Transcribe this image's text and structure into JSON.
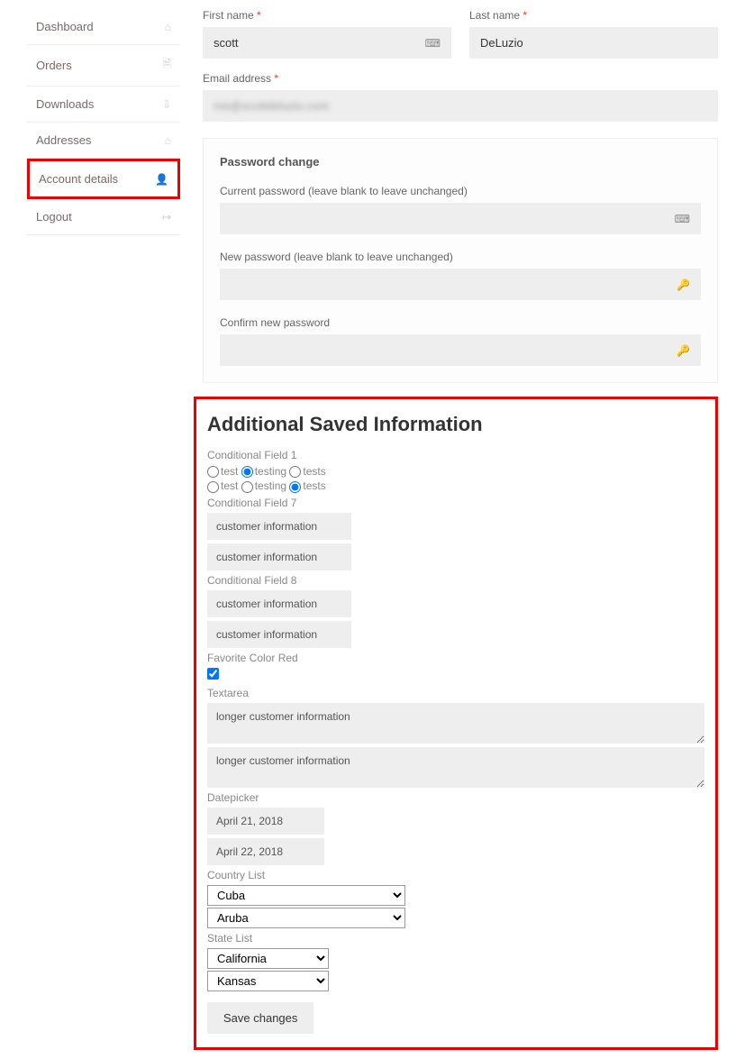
{
  "sidebar": {
    "items": [
      {
        "label": "Dashboard",
        "icon": "⌂"
      },
      {
        "label": "Orders",
        "icon": "🗎"
      },
      {
        "label": "Downloads",
        "icon": "⇩"
      },
      {
        "label": "Addresses",
        "icon": "⌂"
      },
      {
        "label": "Account details",
        "icon": "👤"
      },
      {
        "label": "Logout",
        "icon": "↦"
      }
    ]
  },
  "form": {
    "first_name_label": "First name",
    "first_name_value": "scott",
    "last_name_label": "Last name",
    "last_name_value": "DeLuzio",
    "email_label": "Email address",
    "email_value": "me@scottdeluzio.com",
    "password_section": "Password change",
    "current_pw_label": "Current password (leave blank to leave unchanged)",
    "new_pw_label": "New password (leave blank to leave unchanged)",
    "confirm_pw_label": "Confirm new password"
  },
  "additional": {
    "heading": "Additional Saved Information",
    "cond_field_1": "Conditional Field 1",
    "radio_options": [
      "test",
      "testing",
      "tests"
    ],
    "cond_field_7": "Conditional Field 7",
    "cust_info": "customer information",
    "cond_field_8": "Conditional Field 8",
    "fav_color": "Favorite Color Red",
    "textarea_label": "Textarea",
    "textarea_val": "longer customer information",
    "datepicker_label": "Datepicker",
    "date1": "April 21, 2018",
    "date2": "April 22, 2018",
    "country_label": "Country List",
    "country1": "Cuba",
    "country2": "Aruba",
    "state_label": "State List",
    "state1": "California",
    "state2": "Kansas",
    "save_btn": "Save changes"
  }
}
